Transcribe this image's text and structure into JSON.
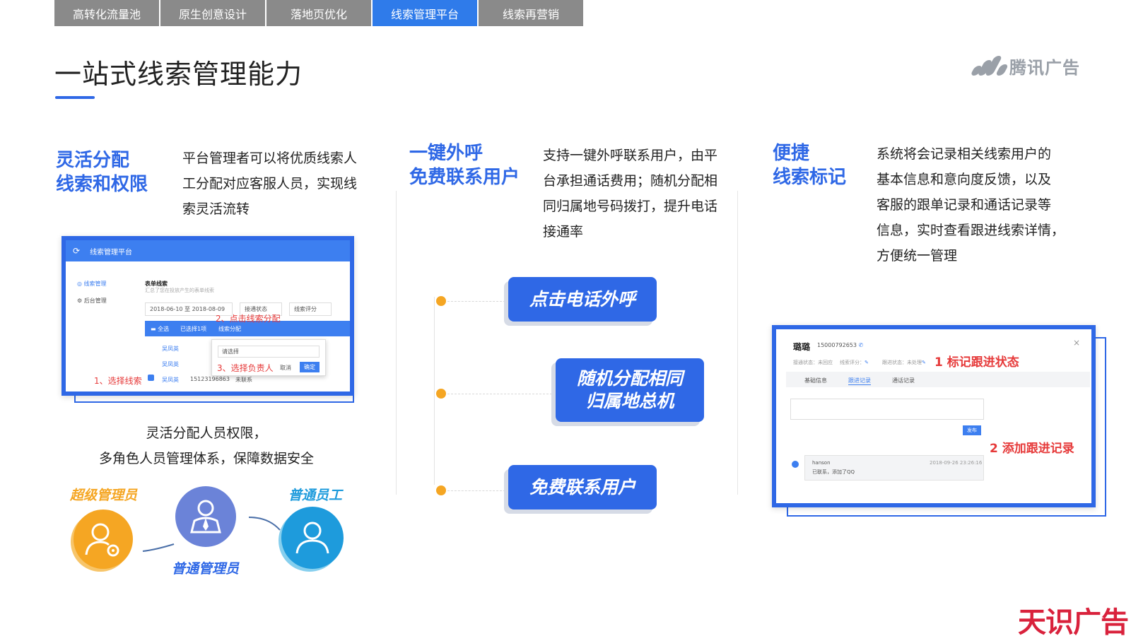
{
  "tabs": [
    "高转化流量池",
    "原生创意设计",
    "落地页优化",
    "线索管理平台",
    "线索再营销"
  ],
  "active_tab": 3,
  "page_title": "一站式线索管理能力",
  "brand_logo_text": "腾讯广告",
  "section1": {
    "title_line1": "灵活分配",
    "title_line2": "线索和权限",
    "desc_line1": "平台管理者可以将优质线索人",
    "desc_line2": "工分配对应客服人员，实现线",
    "desc_line3": "索灵活流转"
  },
  "shot1": {
    "app_title": "线索管理平台",
    "menu_item1": "线索管理",
    "menu_item2": "后台管理",
    "panel_title": "表单线索",
    "panel_subtitle": "汇总了您在投放产生的表单线索",
    "date_range": "2018-06-10 至 2018-08-09",
    "filter1": "接通状态",
    "filter2": "线索评分",
    "toolbar_select_all": "全选",
    "toolbar_selected": "已选择1项",
    "toolbar_assign": "线索分配",
    "row_name": "吴凤英",
    "row_phone": "15123196863",
    "row_status": "未联系",
    "popup_placeholder": "请选择",
    "popup_cancel": "取消",
    "popup_confirm": "确定",
    "step1": "1、选择线索",
    "step2": "2、点击线索分配",
    "step3": "3、选择负责人"
  },
  "roles": {
    "line1": "灵活分配人员权限，",
    "line2": "多角色人员管理体系，保障数据安全",
    "super_admin": "超级管理员",
    "admin": "普通管理员",
    "staff": "普通员工"
  },
  "section2": {
    "title_line1": "一键外呼",
    "title_line2": "免费联系用户",
    "desc_line1": "支持一键外呼联系用户，由平",
    "desc_line2": "台承担通话费用；随机分配相",
    "desc_line3": "同归属地号码拨打，提升电话",
    "desc_line4": "接通率",
    "btn1": "点击电话外呼",
    "btn2_line1": "随机分配相同",
    "btn2_line2": "归属地总机",
    "btn3": "免费联系用户"
  },
  "section3": {
    "title_line1": "便捷",
    "title_line2": "线索标记",
    "desc_line1": "系统将会记录相关线索用户的",
    "desc_line2": "基本信息和意向度反馈，以及",
    "desc_line3": "客服的跟单记录和通话记录等",
    "desc_line4": "信息，实时查看跟进线索详情，",
    "desc_line5": "方便统一管理"
  },
  "shot3": {
    "contact_name": "璐璐",
    "contact_phone": "15000792653",
    "field1": "接通状态：未回应",
    "field2": "线索评分：",
    "field3": "跟进状态：未处理",
    "tab1": "基础信息",
    "tab2": "跟进记录",
    "tab3": "通话记录",
    "publish": "发布",
    "log_user": "hanson",
    "log_time": "2018-09-26 23:26:16",
    "log_text": "已联系，添加了QQ",
    "note1": "1  标记跟进状态",
    "note2": "2  添加跟进记录",
    "close": "×"
  },
  "watermark": "天识广告",
  "colors": {
    "accent": "#2f68e6",
    "tab_gray": "#8a8a8a",
    "orange": "#f5a623",
    "red": "#e63a3a",
    "role_purple": "#6b83d8",
    "role_blue": "#1e9bdc"
  }
}
